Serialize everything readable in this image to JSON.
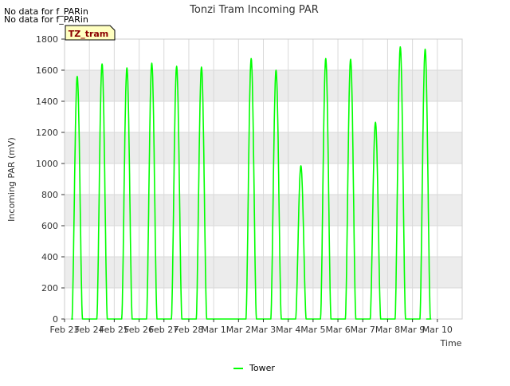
{
  "notes": [
    "No data for f_PARin",
    "No data for f_PARin"
  ],
  "site_badge": "TZ_tram",
  "colors": {
    "series": "#00ff00",
    "band": "#ececec",
    "grid": "#d9d9d9",
    "badge_fill": "#ffffc0",
    "badge_text": "#8b0000"
  },
  "chart_data": {
    "type": "line",
    "title": "Tonzi Tram Incoming PAR",
    "xlabel": "Time",
    "ylabel": "Incoming PAR (mV)",
    "ylim": [
      0,
      1800
    ],
    "yticks": [
      0,
      200,
      400,
      600,
      800,
      1000,
      1200,
      1400,
      1600,
      1800
    ],
    "xlim": [
      "2024-02-23",
      "2024-03-10"
    ],
    "xticks": [
      "Feb 23",
      "Feb 24",
      "Feb 25",
      "Feb 26",
      "Feb 27",
      "Feb 28",
      "Mar 1",
      "Mar 2",
      "Mar 3",
      "Mar 4",
      "Mar 5",
      "Mar 6",
      "Mar 7",
      "Mar 8",
      "Mar 9",
      "Mar 10"
    ],
    "grid": true,
    "legend": {
      "placement": "bottom-center",
      "entries": [
        "Tower"
      ]
    },
    "series": [
      {
        "name": "Tower",
        "color": "#00ff00",
        "daily_peaks": [
          {
            "date": "2024-02-23",
            "peak": 1560
          },
          {
            "date": "2024-02-24",
            "peak": 1640
          },
          {
            "date": "2024-02-25",
            "peak": 1615
          },
          {
            "date": "2024-02-26",
            "peak": 1645
          },
          {
            "date": "2024-02-27",
            "peak": 1625
          },
          {
            "date": "2024-02-28",
            "peak": 1620
          },
          {
            "date": "2024-03-01",
            "peak": 1675
          },
          {
            "date": "2024-03-02",
            "peak": 1600
          },
          {
            "date": "2024-03-03",
            "peak": 985
          },
          {
            "date": "2024-03-04",
            "peak": 1675
          },
          {
            "date": "2024-03-05",
            "peak": 1670
          },
          {
            "date": "2024-03-06",
            "peak": 1265
          },
          {
            "date": "2024-03-07",
            "peak": 1750
          },
          {
            "date": "2024-03-08",
            "peak": 1735
          }
        ]
      }
    ]
  }
}
